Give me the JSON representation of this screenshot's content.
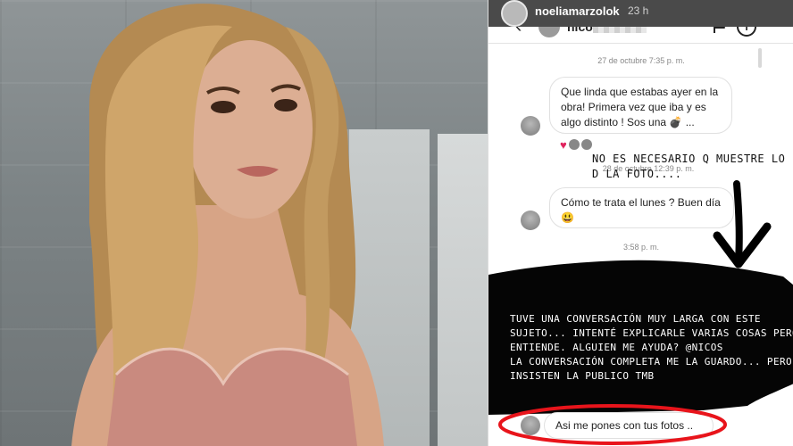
{
  "story": {
    "username": "noeliamarzolok",
    "age": "23 h"
  },
  "dm": {
    "username": "nico",
    "back_icon": "chevron-left-icon",
    "flag_icon": "flag-icon",
    "info_icon": "info-icon",
    "info_glyph": "i"
  },
  "messages": {
    "ts1": "27 de octubre 7:35 p. m.",
    "msg1": "Que linda que estabas ayer en la obra! Primera vez que iba y es algo distinto ! Sos una 💣 ...",
    "ts2": "28 de octubre 12:39 p. m.",
    "msg2": "Cómo te trata el lunes ? Buen día 😃",
    "ts3": "3:58 p. m.",
    "msg3": "Asi me pones con tus fotos .."
  },
  "overlay": {
    "note": "NO ES NECESARIO Q MUESTRE LO\nD LA FOTO....",
    "caption": "TUVE UNA CONVERSACIÓN MUY LARGA CON ESTE\nSUJETO... INTENTÉ EXPLICARLE VARIAS COSAS PERO NO\nENTIENDE. ALGUIEN ME AYUDA? @NICOS\nLA CONVERSACIÓN COMPLETA ME LA GUARDO... PERO\nINSISTEN LA PUBLICO TMB"
  },
  "colors": {
    "highlight_ellipse": "#e8141b",
    "heart": "#e0245e"
  }
}
